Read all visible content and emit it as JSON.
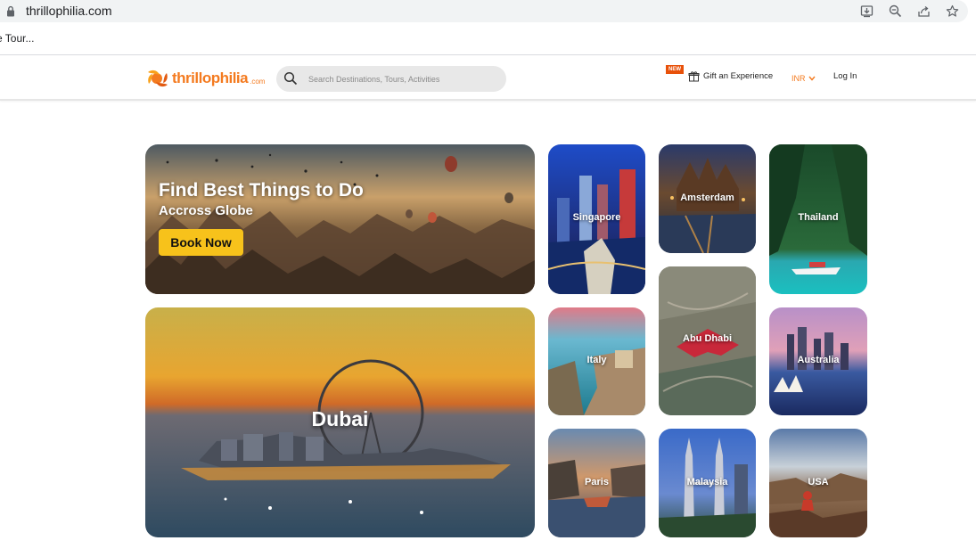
{
  "browser": {
    "url": "thrillophilia.com",
    "bookmark": "e Tour..."
  },
  "header": {
    "logo_text": "thrillophilia",
    "logo_suffix": ".com",
    "search_placeholder": "Search Destinations, Tours, Activities",
    "new_badge": "NEW",
    "gift_label": "Gift an Experience",
    "currency": "INR",
    "login": "Log In"
  },
  "hero": {
    "title": "Find Best Things to Do",
    "subtitle": "Accross Globe",
    "button": "Book Now"
  },
  "featured": {
    "label": "Dubai"
  },
  "destinations": [
    {
      "label": "Singapore"
    },
    {
      "label": "Amsterdam"
    },
    {
      "label": "Thailand"
    },
    {
      "label": "Abu Dhabi"
    },
    {
      "label": "Italy"
    },
    {
      "label": "Australia"
    },
    {
      "label": "Paris"
    },
    {
      "label": "Malaysia"
    },
    {
      "label": "USA"
    }
  ],
  "colors": {
    "brand": "#f47b20",
    "button": "#f7c21b",
    "badge": "#e8510a"
  }
}
